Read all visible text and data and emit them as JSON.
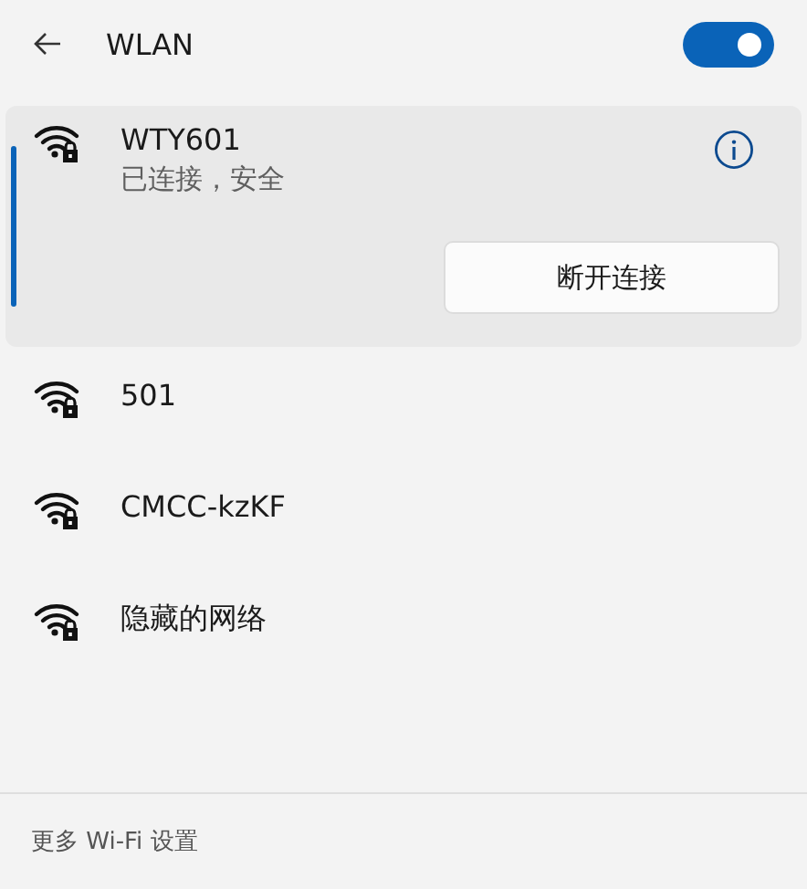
{
  "header": {
    "title": "WLAN",
    "wifi_on": true
  },
  "networks": [
    {
      "name": "WTY601",
      "selected": true,
      "status": "已连接，安全",
      "action": "断开连接"
    },
    {
      "name": "501",
      "selected": false
    },
    {
      "name": "CMCC-kzKF",
      "selected": false
    },
    {
      "name": "隐藏的网络",
      "selected": false
    }
  ],
  "footer": {
    "link": "更多 Wi-Fi 设置"
  }
}
